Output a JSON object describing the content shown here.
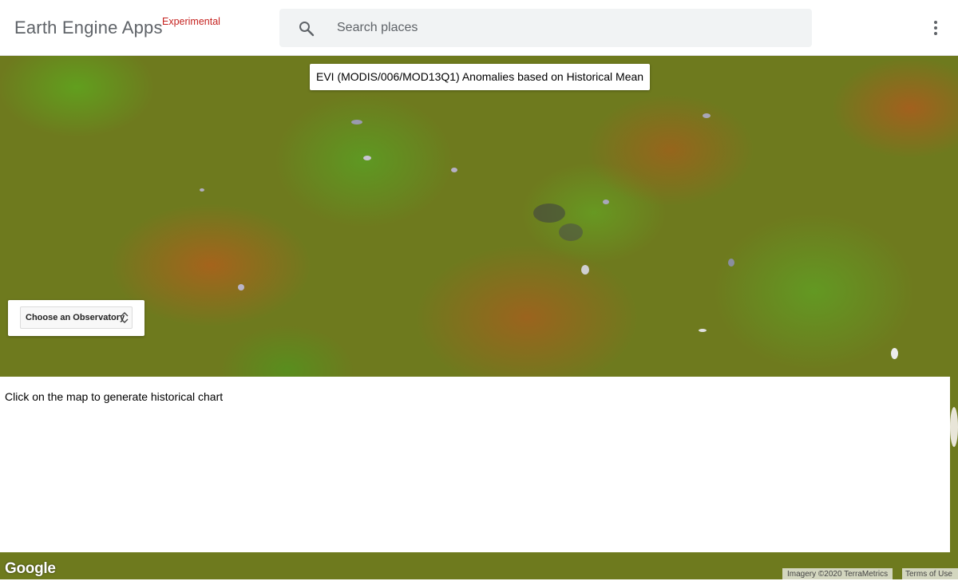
{
  "header": {
    "app_title": "Earth Engine Apps",
    "badge": "Experimental",
    "search": {
      "placeholder": "Search places",
      "value": ""
    },
    "icons": {
      "search": "search-icon",
      "more": "more-vert-icon"
    }
  },
  "map": {
    "title": "EVI (MODIS/006/MOD13Q1) Anomalies based on Historical Mean",
    "observatory_select": {
      "selected": "Choose an Observatory"
    },
    "chart_panel": {
      "prompt": "Click on the map to generate historical chart"
    },
    "footer": {
      "logo": "Google",
      "attribution": "Imagery ©2020 TerraMetrics",
      "terms": "Terms of Use"
    }
  },
  "colors": {
    "accent_red": "#c5221f",
    "anomaly_green": "#5fa51e",
    "anomaly_brown": "#b25e1c",
    "base_olive": "#6e7a1e"
  }
}
